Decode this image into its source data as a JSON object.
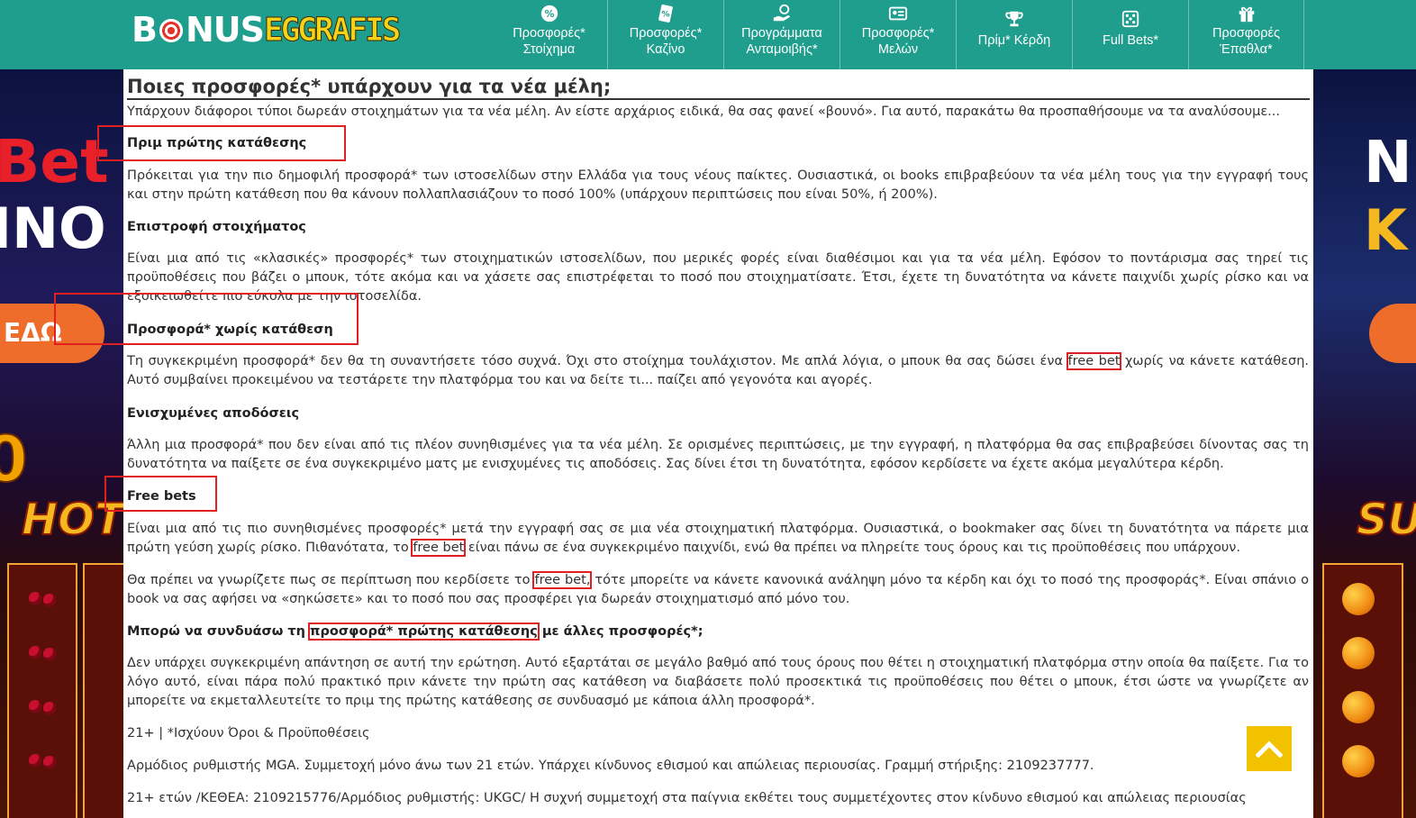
{
  "logo": {
    "part1": "B",
    "part2": "NUS",
    "part3": "EGGRAFIS"
  },
  "nav": [
    {
      "line1": "Προσφορές*",
      "line2": "Στοίχημα",
      "icon": "percent-badge-icon"
    },
    {
      "line1": "Προσφορές*",
      "line2": "Καζίνο",
      "icon": "casino-chip-icon"
    },
    {
      "line1": "Προγράμματα",
      "line2": "Ανταμοιβής*",
      "icon": "hand-coin-icon"
    },
    {
      "line1": "Προσφορές*",
      "line2": "Μελών",
      "icon": "member-card-icon"
    },
    {
      "line1": "Πρίμ* Κέρδη",
      "line2": "",
      "icon": "trophy-icon"
    },
    {
      "line1": "Full Bets*",
      "line2": "",
      "icon": "dice-icon"
    },
    {
      "line1": "Προσφορές",
      "line2": "Έπαθλα*",
      "icon": "gift-icon"
    }
  ],
  "left_banner": {
    "line1": "Bet",
    "line2": "INO",
    "cta": "ΕΔΩ",
    "num": "0",
    "hot": "HOT"
  },
  "right_banner": {
    "line1": "N",
    "line2": "K",
    "hot": "SU"
  },
  "article": {
    "title": "Ποιες προσφορές* υπάρχουν για τα νέα μέλη;",
    "intro": "Υπάρχουν διάφοροι τύποι δωρεάν στοιχημάτων για τα νέα μέλη. Αν είστε αρχάριος ειδικά, θα σας φανεί «βουνό». Για αυτό, παρακάτω θα προσπαθήσουμε να τα αναλύσουμε...",
    "s1_title": "Πριμ πρώτης κατάθεσης",
    "s1_text": "Πρόκειται για την πιο δημοφιλή προσφορά* των ιστοσελίδων στην Ελλάδα για τους νέους παίκτες. Ουσιαστικά, οι books επιβραβεύουν τα νέα μέλη τους για την εγγραφή τους και στην πρώτη κατάθεση που θα κάνουν πολλαπλασιάζουν το ποσό 100% (υπάρχουν περιπτώσεις που είναι 50%, ή 200%).",
    "s2_title": "Επιστροφή στοιχήματος",
    "s2_text": "Είναι μια από τις «κλασικές» προσφορές* των στοιχηματικών ιστοσελίδων, που μερικές φορές είναι διαθέσιμοι και για τα νέα μέλη. Εφόσον το ποντάρισμα σας τηρεί τις προϋποθέσεις που βάζει ο μπουκ, τότε ακόμα και να χάσετε σας επιστρέφεται το ποσό που στοιχηματίσατε. Έτσι, έχετε τη δυνατότητα να κάνετε παιχνίδι χωρίς ρίσκο και να εξοικειωθείτε πιο εύκολα με την ιστοσελίδα.",
    "s3_title": "Προσφορά* χωρίς κατάθεση",
    "s3_text_a": "Τη συγκεκριμένη προσφορά* δεν θα τη συναντήσετε τόσο συχνά. Όχι στο στοίχημα τουλάχιστον. Με απλά λόγια, ο μπουκ θα σας δώσει ένα ",
    "s3_text_hl": "free bet",
    "s3_text_b": " χωρίς να κάνετε κατάθεση. Αυτό συμβαίνει προκειμένου να τεστάρετε την πλατφόρμα του και να δείτε τι... παίζει από γεγονότα και αγορές.",
    "s4_title": "Ενισχυμένες αποδόσεις",
    "s4_text": "Άλλη μια προσφορά* που δεν είναι από τις πλέον συνηθισμένες για τα νέα μέλη. Σε ορισμένες περιπτώσεις, με την εγγραφή, η πλατφόρμα θα σας επιβραβεύσει δίνοντας σας τη δυνατότητα να παίξετε σε ένα συγκεκριμένο ματς με ενισχυμένες τις αποδόσεις. Σας δίνει έτσι τη δυνατότητα, εφόσον κερδίσετε να έχετε ακόμα μεγαλύτερα κέρδη.",
    "s5_title": "Free bets",
    "s5_text_a": "Είναι μια από τις πιο συνηθισμένες προσφορές* μετά την εγγραφή σας σε μια νέα στοιχηματική πλατφόρμα. Ουσιαστικά, ο bookmaker σας δίνει τη δυνατότητα να πάρετε μια πρώτη γεύση χωρίς ρίσκο. Πιθανότατα, το ",
    "s5_text_hl": "free bet",
    "s5_text_b": " είναι πάνω σε ένα συγκεκριμένο παιχνίδι, ενώ θα πρέπει να πληρείτε τους όρους και τις προϋποθέσεις που υπάρχουν.",
    "s5_text2_a": "Θα πρέπει να γνωρίζετε πως σε περίπτωση που κερδίσετε το ",
    "s5_text2_hl": "free bet,",
    "s5_text2_b": " τότε μπορείτε να κάνετε κανονικά ανάληψη μόνο τα κέρδη και όχι το ποσό της προσφοράς*. Είναι σπάνιο ο book να σας αφήσει να «σηκώσετε» και το ποσό που σας προσφέρει για δωρεάν στοιχηματισμό από μόνο του.",
    "s6_title_a": "Μπορώ να συνδυάσω τη ",
    "s6_title_hl": "προσφορά* πρώτης κατάθεσης",
    "s6_title_b": " με άλλες προσφορές*;",
    "s6_text": "Δεν υπάρχει συγκεκριμένη απάντηση σε αυτή την ερώτηση. Αυτό εξαρτάται σε μεγάλο βαθμό από τους όρους που θέτει η στοιχηματική πλατφόρμα στην οποία θα παίξετε. Για το λόγο αυτό, είναι πάρα πολύ πρακτικό πριν κάνετε την πρώτη σας κατάθεση να διαβάσετε πολύ προσεκτικά τις προϋποθέσεις που θέτει ο μπουκ, έτσι ώστε να γνωρίζετε αν μπορείτε να εκμεταλλευτείτε το πριμ της πρώτης κατάθεσης σε συνδυασμό με κάποια άλλη προσφορά*.",
    "footer1": "21+ | *Ισχύουν Όροι & Προϋποθέσεις",
    "footer2": "Αρμόδιος ρυθμιστής MGA. Συμμετοχή μόνο άνω των 21 ετών. Υπάρχει κίνδυνος εθισμού και απώλειας περιουσίας. Γραμμή στήριξης: 2109237777.",
    "footer3": "21+ ετών /ΚΕΘΕΑ: 2109215776/Αρμόδιος ρυθμιστής: UKGC/ Η συχνή συμμετοχή στα παίγνια εκθέτει τους συμμετέχοντες στον κίνδυνο εθισμού και απώλειας περιουσίας"
  },
  "colors": {
    "header": "#1f9e8e",
    "highlight": "#e02020",
    "to_top": "#f2c200"
  },
  "to_top_icon": "chevron-up-icon"
}
